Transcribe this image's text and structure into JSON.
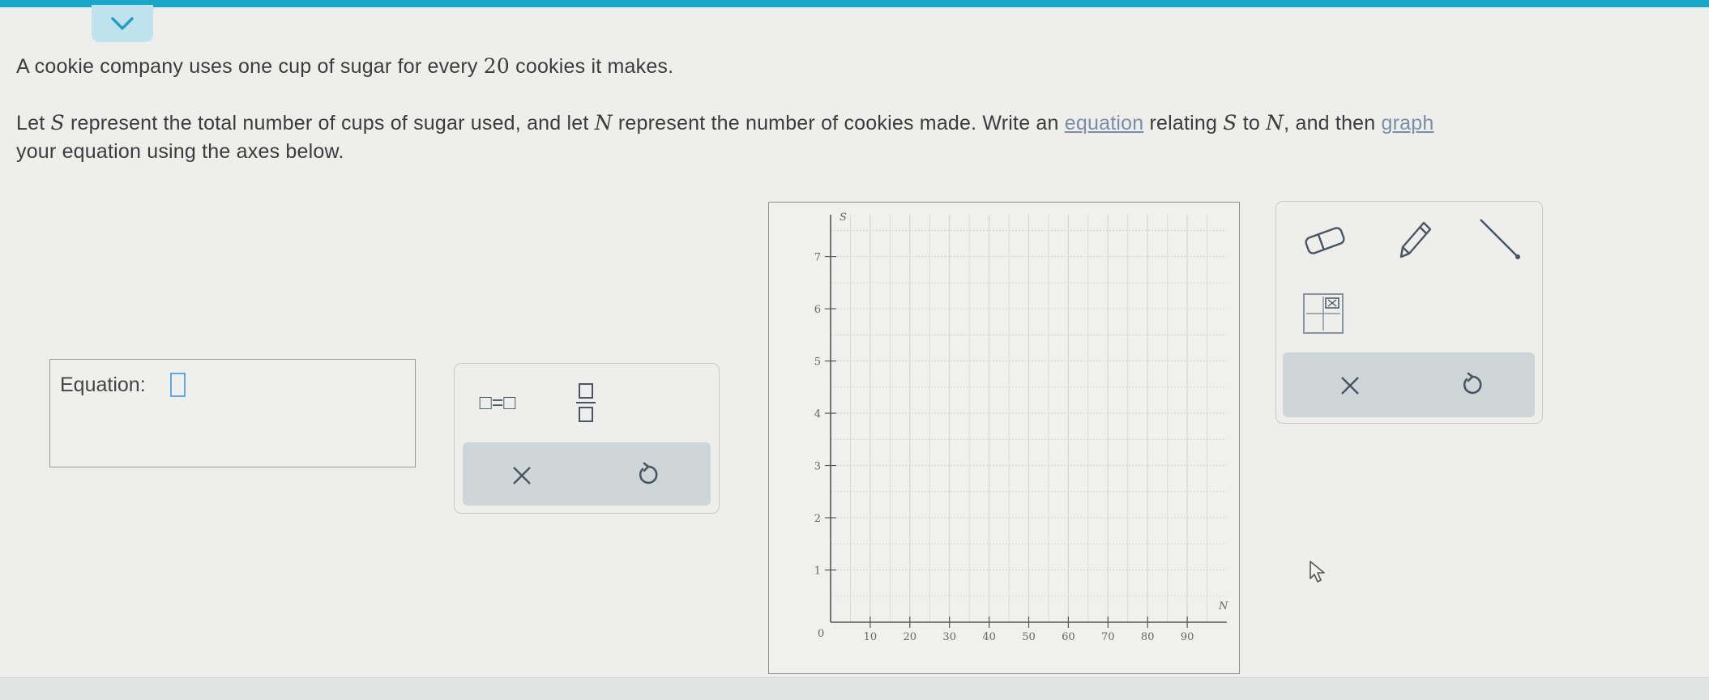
{
  "problem": {
    "line1_before": "A cookie company uses one cup of sugar for every ",
    "line1_number": "20",
    "line1_after": " cookies it makes.",
    "line2_a": "Let ",
    "var_s": "S",
    "line2_b": " represent the total number of cups of sugar used, and let ",
    "var_n": "N",
    "line2_c": " represent the number of cookies made. Write an ",
    "link_equation": "equation",
    "line2_d": " relating ",
    "line2_e": " to ",
    "line2_f": ", and then ",
    "link_graph": "graph",
    "line3": "your equation using the axes below."
  },
  "equation": {
    "label": "Equation:"
  },
  "palette": {
    "equals_template": "□=□",
    "fraction_template": "fraction",
    "clear": "×",
    "undo": "undo"
  },
  "graph": {
    "y_axis_label": "S",
    "x_axis_label": "N",
    "origin_label": "0",
    "x_ticks": [
      "10",
      "20",
      "30",
      "40",
      "50",
      "60",
      "70",
      "80",
      "90"
    ],
    "y_ticks": [
      "1",
      "2",
      "3",
      "4",
      "5",
      "6",
      "7"
    ],
    "x_range": [
      0,
      100
    ],
    "y_range": [
      0,
      7.8
    ],
    "grid": true
  },
  "graph_tools": {
    "eraser": "eraser-icon",
    "pencil": "pencil-icon",
    "line": "line-segment-icon",
    "graph_settings": "graph-settings-icon",
    "clear": "×",
    "undo": "undo"
  },
  "colors": {
    "topbar": "#18a6c9",
    "accent_blue": "#5da9e0",
    "icon_gray": "#556270"
  }
}
